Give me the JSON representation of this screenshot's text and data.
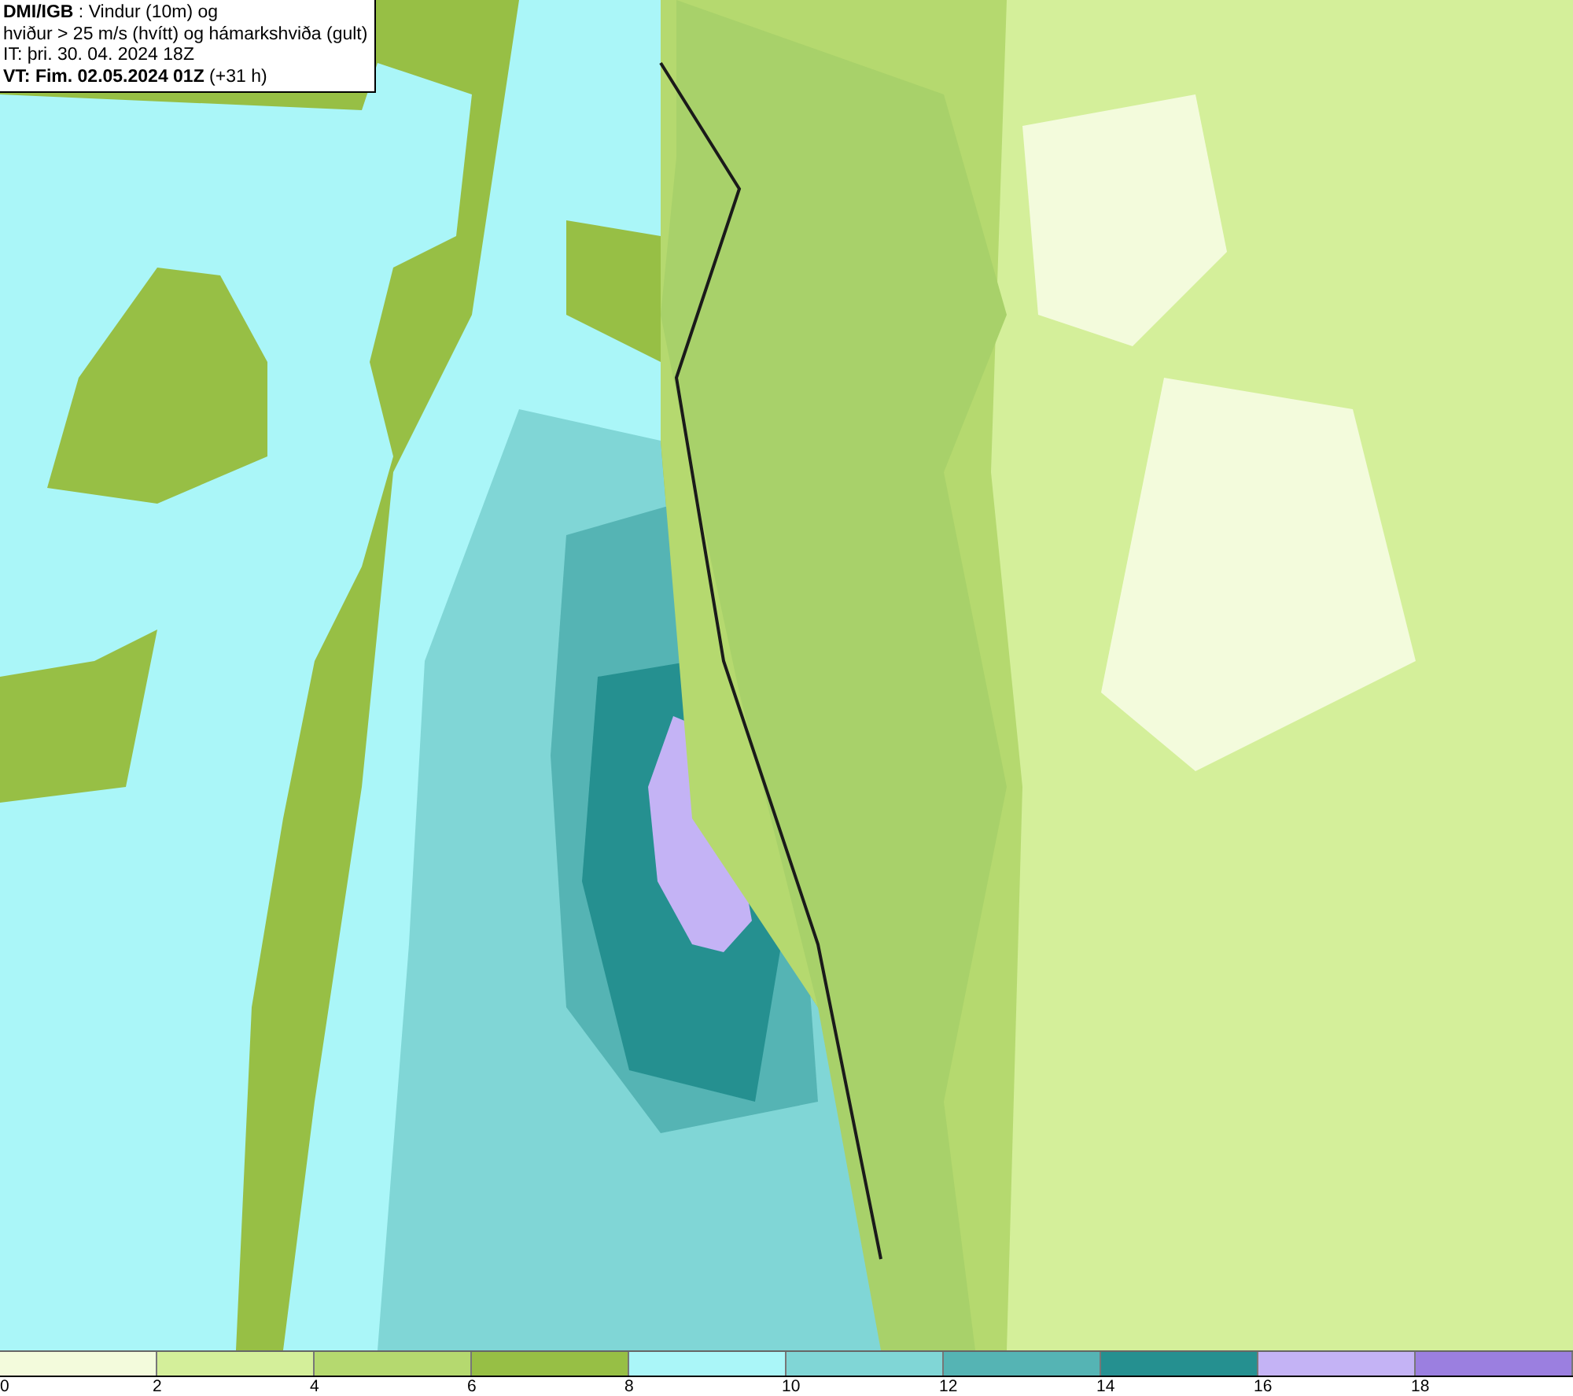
{
  "title_box": {
    "lines": [
      "**DMI/IGB** : Vindur (10m) og",
      "hviður > 25 m/s (hvítt) og hámarkshviða (gult)",
      "IT: þri. 30. 04. 2024 18Z",
      "**VT: Fim. 02.05.2024 01Z** (+31 h)"
    ]
  },
  "legend": {
    "bins": [
      {
        "label": "0",
        "color": "#f3fbdc"
      },
      {
        "label": "2",
        "color": "#d4ef9a"
      },
      {
        "label": "4",
        "color": "#b5d96f"
      },
      {
        "label": "6",
        "color": "#97bf45"
      },
      {
        "label": "8",
        "color": "#aaf6f8"
      },
      {
        "label": "10",
        "color": "#80d6d6"
      },
      {
        "label": "12",
        "color": "#55b4b4"
      },
      {
        "label": "14",
        "color": "#259090"
      },
      {
        "label": "16",
        "color": "#c4b3f5"
      },
      {
        "label": "18",
        "color": "#9b7fe0"
      }
    ]
  }
}
